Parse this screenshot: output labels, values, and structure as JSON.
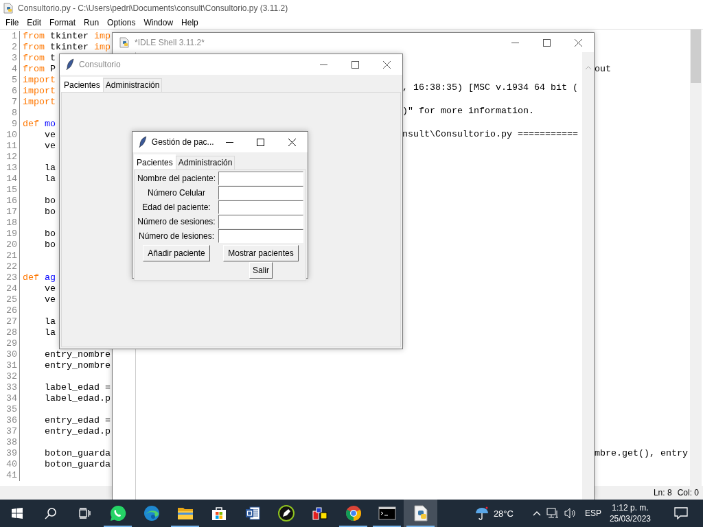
{
  "editor": {
    "title": "Consultorio.py - C:\\Users\\pedri\\Documents\\consult\\Consultorio.py (3.11.2)",
    "menu": [
      "File",
      "Edit",
      "Format",
      "Run",
      "Options",
      "Window",
      "Help"
    ],
    "lines": [
      {
        "number": "1",
        "tokens": [
          {
            "text": "from",
            "kind": "keyword"
          },
          {
            "text": " tkinter ",
            "kind": "plain"
          },
          {
            "text": "imp",
            "kind": "keyword"
          }
        ]
      },
      {
        "number": "2",
        "tokens": [
          {
            "text": "from",
            "kind": "keyword"
          },
          {
            "text": " tkinter ",
            "kind": "plain"
          },
          {
            "text": "imp",
            "kind": "keyword"
          }
        ]
      },
      {
        "number": "3",
        "tokens": [
          {
            "text": "from",
            "kind": "keyword"
          },
          {
            "text": " t",
            "kind": "plain"
          }
        ]
      },
      {
        "number": "4",
        "tokens": [
          {
            "text": "from",
            "kind": "keyword"
          },
          {
            "text": " P",
            "kind": "plain"
          }
        ],
        "tail": "out"
      },
      {
        "number": "5",
        "tokens": [
          {
            "text": "import",
            "kind": "keyword"
          }
        ]
      },
      {
        "number": "6",
        "tokens": [
          {
            "text": "import",
            "kind": "keyword"
          }
        ]
      },
      {
        "number": "7",
        "tokens": [
          {
            "text": "import",
            "kind": "keyword"
          }
        ]
      },
      {
        "number": "8"
      },
      {
        "number": "9",
        "tokens": [
          {
            "text": "def",
            "kind": "keyword"
          },
          {
            "text": " mo",
            "kind": "definition"
          }
        ]
      },
      {
        "number": "10",
        "tokens": [
          {
            "text": "    ve",
            "kind": "plain"
          }
        ]
      },
      {
        "number": "11",
        "tokens": [
          {
            "text": "    ve",
            "kind": "plain"
          }
        ]
      },
      {
        "number": "12"
      },
      {
        "number": "13",
        "tokens": [
          {
            "text": "    la",
            "kind": "plain"
          }
        ]
      },
      {
        "number": "14",
        "tokens": [
          {
            "text": "    la",
            "kind": "plain"
          }
        ]
      },
      {
        "number": "15"
      },
      {
        "number": "16",
        "tokens": [
          {
            "text": "    bo",
            "kind": "plain"
          }
        ]
      },
      {
        "number": "17",
        "tokens": [
          {
            "text": "    bo",
            "kind": "plain"
          }
        ]
      },
      {
        "number": "18"
      },
      {
        "number": "19",
        "tokens": [
          {
            "text": "    bo",
            "kind": "plain"
          }
        ]
      },
      {
        "number": "20",
        "tokens": [
          {
            "text": "    bo",
            "kind": "plain"
          }
        ]
      },
      {
        "number": "21"
      },
      {
        "number": "22"
      },
      {
        "number": "23",
        "tokens": [
          {
            "text": "def",
            "kind": "keyword"
          },
          {
            "text": " ag",
            "kind": "definition"
          }
        ]
      },
      {
        "number": "24",
        "tokens": [
          {
            "text": "    ve",
            "kind": "plain"
          }
        ]
      },
      {
        "number": "25",
        "tokens": [
          {
            "text": "    ve",
            "kind": "plain"
          }
        ]
      },
      {
        "number": "26"
      },
      {
        "number": "27",
        "tokens": [
          {
            "text": "    la",
            "kind": "plain"
          }
        ]
      },
      {
        "number": "28",
        "tokens": [
          {
            "text": "    la",
            "kind": "plain"
          }
        ]
      },
      {
        "number": "29"
      },
      {
        "number": "30",
        "tokens": [
          {
            "text": "    entry_nombre",
            "kind": "plain"
          }
        ]
      },
      {
        "number": "31",
        "tokens": [
          {
            "text": "    entry_nombre",
            "kind": "plain"
          }
        ]
      },
      {
        "number": "32"
      },
      {
        "number": "33",
        "tokens": [
          {
            "text": "    label_edad =",
            "kind": "plain"
          }
        ]
      },
      {
        "number": "34",
        "tokens": [
          {
            "text": "    label_edad.p",
            "kind": "plain"
          }
        ]
      },
      {
        "number": "35"
      },
      {
        "number": "36",
        "tokens": [
          {
            "text": "    entry_edad =",
            "kind": "plain"
          }
        ]
      },
      {
        "number": "37",
        "tokens": [
          {
            "text": "    entry_edad.p",
            "kind": "plain"
          }
        ]
      },
      {
        "number": "38"
      },
      {
        "number": "39",
        "tokens": [
          {
            "text": "    boton_guarda",
            "kind": "plain"
          }
        ],
        "tail": "mbre.get(), entry"
      },
      {
        "number": "40",
        "tokens": [
          {
            "text": "    boton_guarda",
            "kind": "plain"
          }
        ]
      },
      {
        "number": "41"
      }
    ],
    "status": [
      "Ln: 8",
      "Col: 0"
    ]
  },
  "shell": {
    "title": "*IDLE Shell 3.11.2*",
    "lines": [
      ", 16:38:35) [MSC v.1934 64 bit (",
      ")\" for more information.",
      "nsult\\Consultorio.py ==========="
    ]
  },
  "consultorio": {
    "title": "Consultorio",
    "tabs": [
      {
        "label": "Pacientes",
        "selected": true
      },
      {
        "label": "Administración",
        "selected": false
      }
    ]
  },
  "dialog": {
    "title": "Gestión de pac...",
    "tabs": [
      {
        "label": "Pacientes",
        "selected": true
      },
      {
        "label": "Administración",
        "selected": false
      }
    ],
    "fields": [
      {
        "label": "Nombre del paciente:"
      },
      {
        "label": "Número Celular"
      },
      {
        "label": "Edad del paciente:"
      },
      {
        "label": "Número de sesiones:"
      },
      {
        "label": "Número de lesiones:"
      }
    ],
    "buttons": [
      "Añadir paciente",
      "Mostrar pacientes",
      "Salir"
    ]
  },
  "taskbar": {
    "apps": [
      {
        "kind": "whatsapp",
        "running": true,
        "selected": false
      },
      {
        "kind": "edge",
        "running": false,
        "selected": false
      },
      {
        "kind": "explorer",
        "running": true,
        "selected": false
      },
      {
        "kind": "store",
        "running": false,
        "selected": false
      },
      {
        "kind": "word",
        "running": false,
        "selected": false
      },
      {
        "kind": "pen",
        "running": false,
        "selected": false
      },
      {
        "kind": "blocks",
        "running": false,
        "selected": false
      },
      {
        "kind": "chrome",
        "running": true,
        "selected": false
      },
      {
        "kind": "terminal",
        "running": true,
        "selected": false
      },
      {
        "kind": "python",
        "running": true,
        "selected": true
      }
    ],
    "temperature": "28°C",
    "language": "ESP",
    "time": "1:12 p. m.",
    "date": "25/03/2023"
  }
}
